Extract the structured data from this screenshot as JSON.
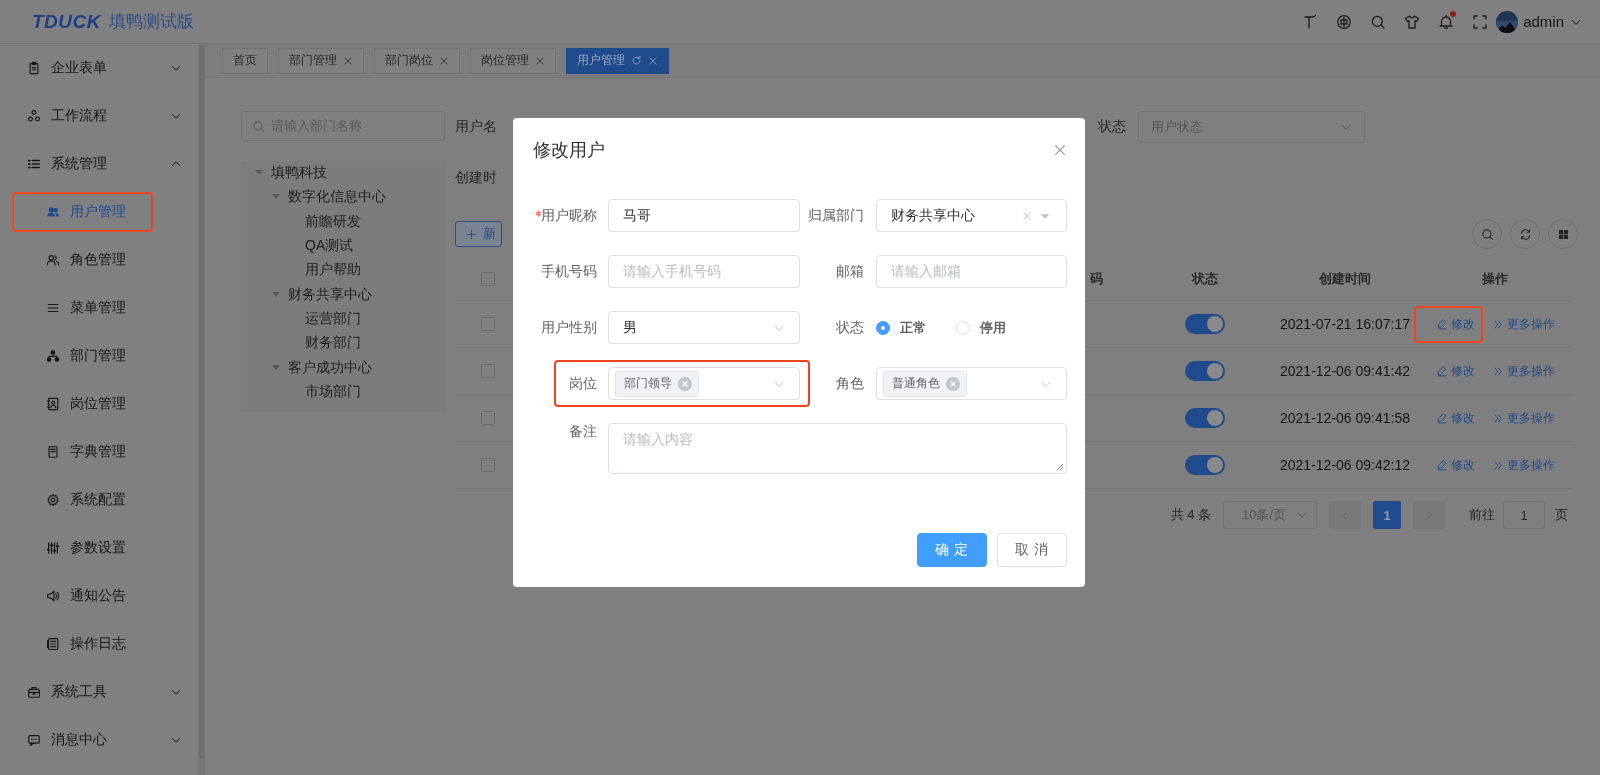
{
  "header": {
    "logo": "TDUCK",
    "title": "填鸭测试版",
    "has_unread": true,
    "user": "admin"
  },
  "sidebar": {
    "items": [
      {
        "label": "企业表单",
        "expanded": false
      },
      {
        "label": "工作流程",
        "expanded": false
      },
      {
        "label": "系统管理",
        "expanded": true,
        "children": [
          {
            "label": "用户管理",
            "selected": true,
            "highlighted": true
          },
          {
            "label": "角色管理",
            "selected": false,
            "highlighted": false
          },
          {
            "label": "菜单管理",
            "selected": false,
            "highlighted": false
          },
          {
            "label": "部门管理",
            "selected": false,
            "highlighted": false
          },
          {
            "label": "岗位管理",
            "selected": false,
            "highlighted": false
          },
          {
            "label": "字典管理",
            "selected": false,
            "highlighted": false
          },
          {
            "label": "系统配置",
            "selected": false,
            "highlighted": false
          },
          {
            "label": "参数设置",
            "selected": false,
            "highlighted": false
          },
          {
            "label": "通知公告",
            "selected": false,
            "highlighted": false
          },
          {
            "label": "操作日志",
            "selected": false,
            "highlighted": false
          }
        ]
      },
      {
        "label": "系统工具",
        "expanded": false
      },
      {
        "label": "消息中心",
        "expanded": false
      }
    ]
  },
  "tabs": [
    {
      "label": "首页",
      "selected": false,
      "closable": false,
      "refresh": false
    },
    {
      "label": "部门管理",
      "selected": false,
      "closable": true,
      "refresh": false
    },
    {
      "label": "部门岗位",
      "selected": false,
      "closable": true,
      "refresh": false
    },
    {
      "label": "岗位管理",
      "selected": false,
      "closable": true,
      "refresh": false
    },
    {
      "label": "用户管理",
      "selected": true,
      "closable": true,
      "refresh": true
    }
  ],
  "dept_search": {
    "placeholder": "请输入部门名称"
  },
  "dept_tree": [
    {
      "label": "填鸭科技",
      "expanded": true,
      "children": [
        {
          "label": "数字化信息中心",
          "expanded": true,
          "children": [
            {
              "label": "前瞻研发"
            },
            {
              "label": "QA测试"
            },
            {
              "label": "用户帮助"
            }
          ]
        },
        {
          "label": "财务共享中心",
          "expanded": true,
          "children": [
            {
              "label": "运营部门"
            },
            {
              "label": "财务部门"
            }
          ]
        },
        {
          "label": "客户成功中心",
          "expanded": true,
          "children": [
            {
              "label": "市场部门"
            }
          ]
        }
      ]
    }
  ],
  "filters": {
    "name_label": "用户名",
    "status_label": "状态",
    "status_placeholder": "用户状态",
    "created_label": "创建时"
  },
  "new_button": "新",
  "table": {
    "header_checked": false,
    "columns": [
      "码",
      "状态",
      "创建时间",
      "操作"
    ],
    "rows": [
      {
        "checked": false,
        "enabled": true,
        "created": "2021-07-21 16:07:17",
        "edit": "修改",
        "more": "更多操作",
        "highlighted": true
      },
      {
        "checked": false,
        "enabled": true,
        "created": "2021-12-06 09:41:42",
        "edit": "修改",
        "more": "更多操作",
        "highlighted": false
      },
      {
        "checked": false,
        "enabled": true,
        "created": "2021-12-06 09:41:58",
        "edit": "修改",
        "more": "更多操作",
        "highlighted": false
      },
      {
        "checked": false,
        "enabled": true,
        "created": "2021-12-06 09:42:12",
        "edit": "修改",
        "more": "更多操作",
        "highlighted": false
      }
    ]
  },
  "pagination": {
    "total": "共 4 条",
    "page_size": "10条/页",
    "pages": [
      {
        "label": "1",
        "selected": true
      }
    ],
    "goto_label": "前往",
    "goto_value": "1",
    "goto_suffix": "页"
  },
  "dialog": {
    "title": "修改用户",
    "fields": [
      {
        "kind": "input",
        "label": "用户昵称",
        "required": true,
        "value": "马哥"
      },
      {
        "kind": "select",
        "label": "归属部门",
        "required": false,
        "value": "财务共享中心",
        "clearable": true
      },
      {
        "kind": "input",
        "label": "手机号码",
        "required": false,
        "placeholder": "请输入手机号码"
      },
      {
        "kind": "input",
        "label": "邮箱",
        "required": false,
        "placeholder": "请输入邮箱"
      },
      {
        "kind": "select",
        "label": "用户性别",
        "required": false,
        "value": "男",
        "clearable": false
      },
      {
        "kind": "radio",
        "label": "状态",
        "required": false,
        "options": [
          {
            "label": "正常",
            "selected": true
          },
          {
            "label": "停用",
            "selected": false
          }
        ]
      },
      {
        "kind": "tags",
        "label": "岗位",
        "required": false,
        "tags": [
          "部门领导"
        ],
        "highlighted": true
      },
      {
        "kind": "tags",
        "label": "角色",
        "required": false,
        "tags": [
          "普通角色"
        ],
        "highlighted": false
      },
      {
        "kind": "textarea",
        "label": "备注",
        "required": false,
        "placeholder": "请输入内容"
      }
    ],
    "buttons": [
      {
        "label": "确 定",
        "kind": "primary"
      },
      {
        "label": "取 消",
        "kind": "default"
      }
    ]
  }
}
